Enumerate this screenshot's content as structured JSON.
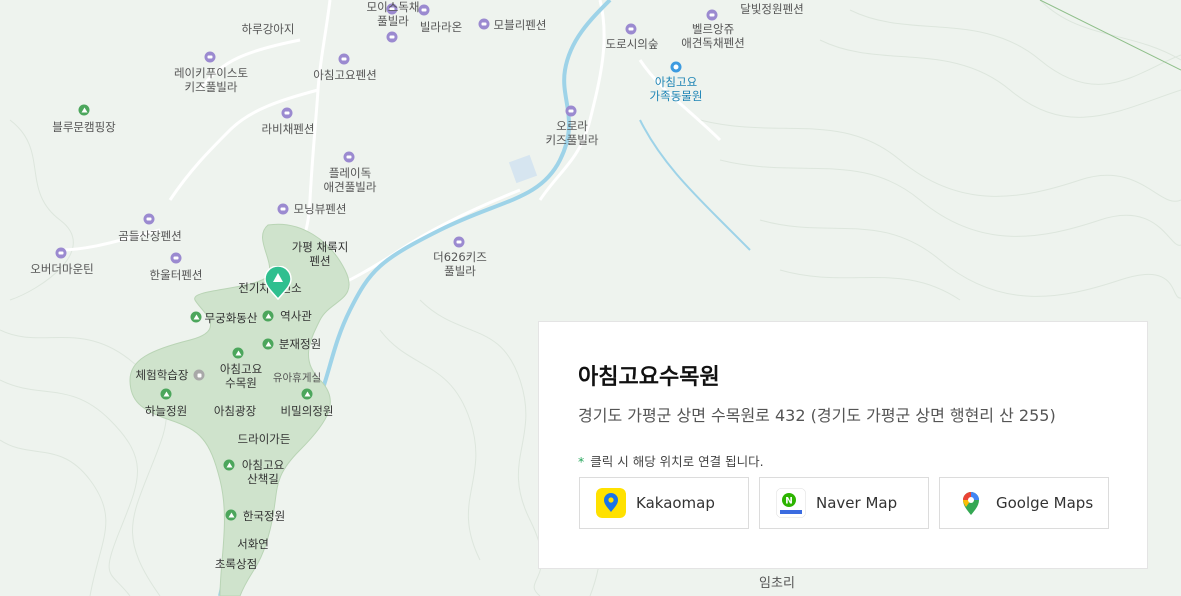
{
  "place": {
    "name": "아침고요수목원",
    "address": "경기도 가평군 상면 수목원로 432 (경기도 가평군 상면 행현리 산 255)",
    "note_star": "*",
    "note": "클릭 시 해당 위치로 연결 됩니다."
  },
  "buttons": {
    "kakao": "Kakaomap",
    "naver": "Naver Map",
    "google": "Goolge Maps"
  },
  "map_labels": {
    "moice": "모이스독채\n풀빌라",
    "harugang": "하루강아지",
    "villa_lune": "빌라라온",
    "mobly": "모블리펜션",
    "dalbit": "달빛정원펜션",
    "doroshi": "도로시의숲",
    "belleangel": "벨르앙쥬\n애견독채펜션",
    "raykifu": "레이키푸이스토\n키즈풀빌라",
    "achimgoyo_pension": "아침고요펜션",
    "achimgoyo_zoo": "아침고요\n가족동물원",
    "bluemoon": "블루문캠핑장",
    "rabi": "라비채펜션",
    "orora": "오로라\n키즈풀빌라",
    "playdog": "플레이독\n애견풀빌라",
    "morningview": "모닝뷰펜션",
    "gomdeul": "곰들산장펜션",
    "gapyeong_chaerok": "가평 채록지\n펜션",
    "the626": "더626키즈\n풀빌라",
    "overthemountain": "오버더마운틴",
    "hanultree": "한울터펜션",
    "ev_station": "전기차충전소",
    "mugunghwa": "무궁화동산",
    "history": "역사관",
    "bonsai": "분재정원",
    "experience": "체험학습장",
    "arboretum": "아침고요\n수목원",
    "nursing": "유아휴게실",
    "haneul": "하늘정원",
    "plaza": "아침광장",
    "secret": "비밀의정원",
    "drygarden": "드라이가든",
    "trail": "아침고요\n산책길",
    "korean": "한국정원",
    "seohwa": "서화연",
    "chorok": "초록상점",
    "imchori": "임초리"
  }
}
